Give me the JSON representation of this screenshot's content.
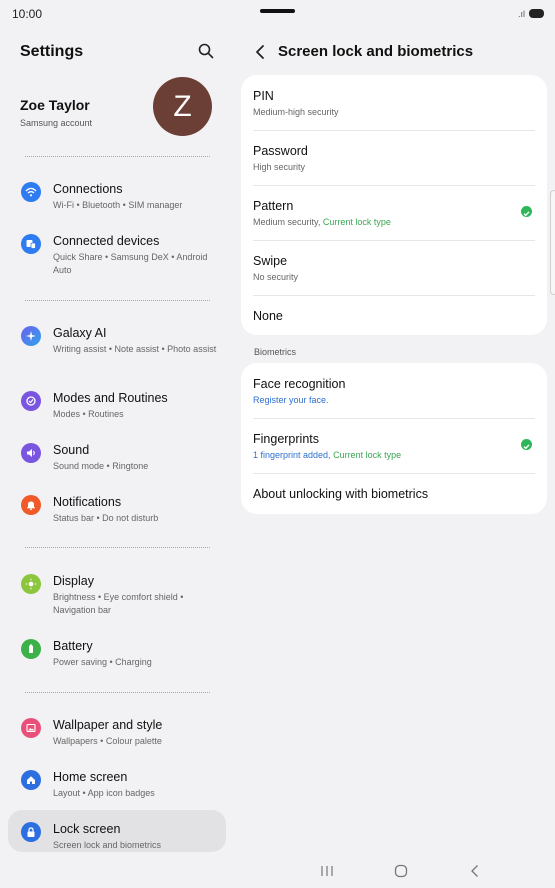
{
  "status_bar": {
    "time": "10:00"
  },
  "left": {
    "title": "Settings",
    "profile": {
      "name": "Zoe Taylor",
      "sub": "Samsung account",
      "avatar_letter": "Z"
    },
    "groups": [
      [
        {
          "label": "Connections",
          "sub": "Wi-Fi • Bluetooth • SIM manager",
          "icon": "wifi-icon",
          "color": "#2e7bf2"
        },
        {
          "label": "Connected devices",
          "sub": "Quick Share • Samsung DeX • Android Auto",
          "icon": "devices-icon",
          "color": "#2e7bf2"
        }
      ],
      [
        {
          "label": "Galaxy AI",
          "sub": "Writing assist • Note assist • Photo assist",
          "icon": "galaxy-ai-icon",
          "color": "#4f6ef2"
        },
        {
          "label": "Modes and Routines",
          "sub": "Modes • Routines",
          "icon": "modes-icon",
          "color": "#7a55e0"
        },
        {
          "label": "Sound",
          "sub": "Sound mode • Ringtone",
          "icon": "sound-icon",
          "color": "#7a55e0"
        },
        {
          "label": "Notifications",
          "sub": "Status bar • Do not disturb",
          "icon": "bell-icon",
          "color": "#f05a28"
        }
      ],
      [
        {
          "label": "Display",
          "sub": "Brightness • Eye comfort shield • Navigation bar",
          "icon": "display-icon",
          "color": "#7cc235"
        },
        {
          "label": "Battery",
          "sub": "Power saving • Charging",
          "icon": "battery-icon",
          "color": "#3cb14a"
        }
      ],
      [
        {
          "label": "Wallpaper and style",
          "sub": "Wallpapers • Colour palette",
          "icon": "wallpaper-icon",
          "color": "#e8507a"
        },
        {
          "label": "Home screen",
          "sub": "Layout • App icon badges",
          "icon": "home-icon",
          "color": "#2e6fe0"
        },
        {
          "label": "Lock screen",
          "sub": "Screen lock and biometrics",
          "icon": "lock-icon",
          "color": "#2e6fe0"
        }
      ]
    ]
  },
  "right": {
    "title": "Screen lock and biometrics",
    "lock_types": [
      {
        "title": "PIN",
        "sub": "Medium-high security"
      },
      {
        "title": "Password",
        "sub": "High security"
      },
      {
        "title": "Pattern",
        "sub": "Medium security, ",
        "sub_extra": "Current lock type",
        "checked": true
      },
      {
        "title": "Swipe",
        "sub": "No security"
      },
      {
        "title": "None"
      }
    ],
    "biometrics_label": "Biometrics",
    "biometrics": [
      {
        "title": "Face recognition",
        "sub": "Register your face."
      },
      {
        "title": "Fingerprints",
        "sub": "1 fingerprint added, ",
        "sub_extra": "Current lock type",
        "checked": true
      },
      {
        "title": "About unlocking with biometrics"
      }
    ]
  },
  "colors": {
    "accent_blue": "#2f6fcf",
    "accent_green": "#3aa654",
    "check_green": "#2fb659"
  }
}
